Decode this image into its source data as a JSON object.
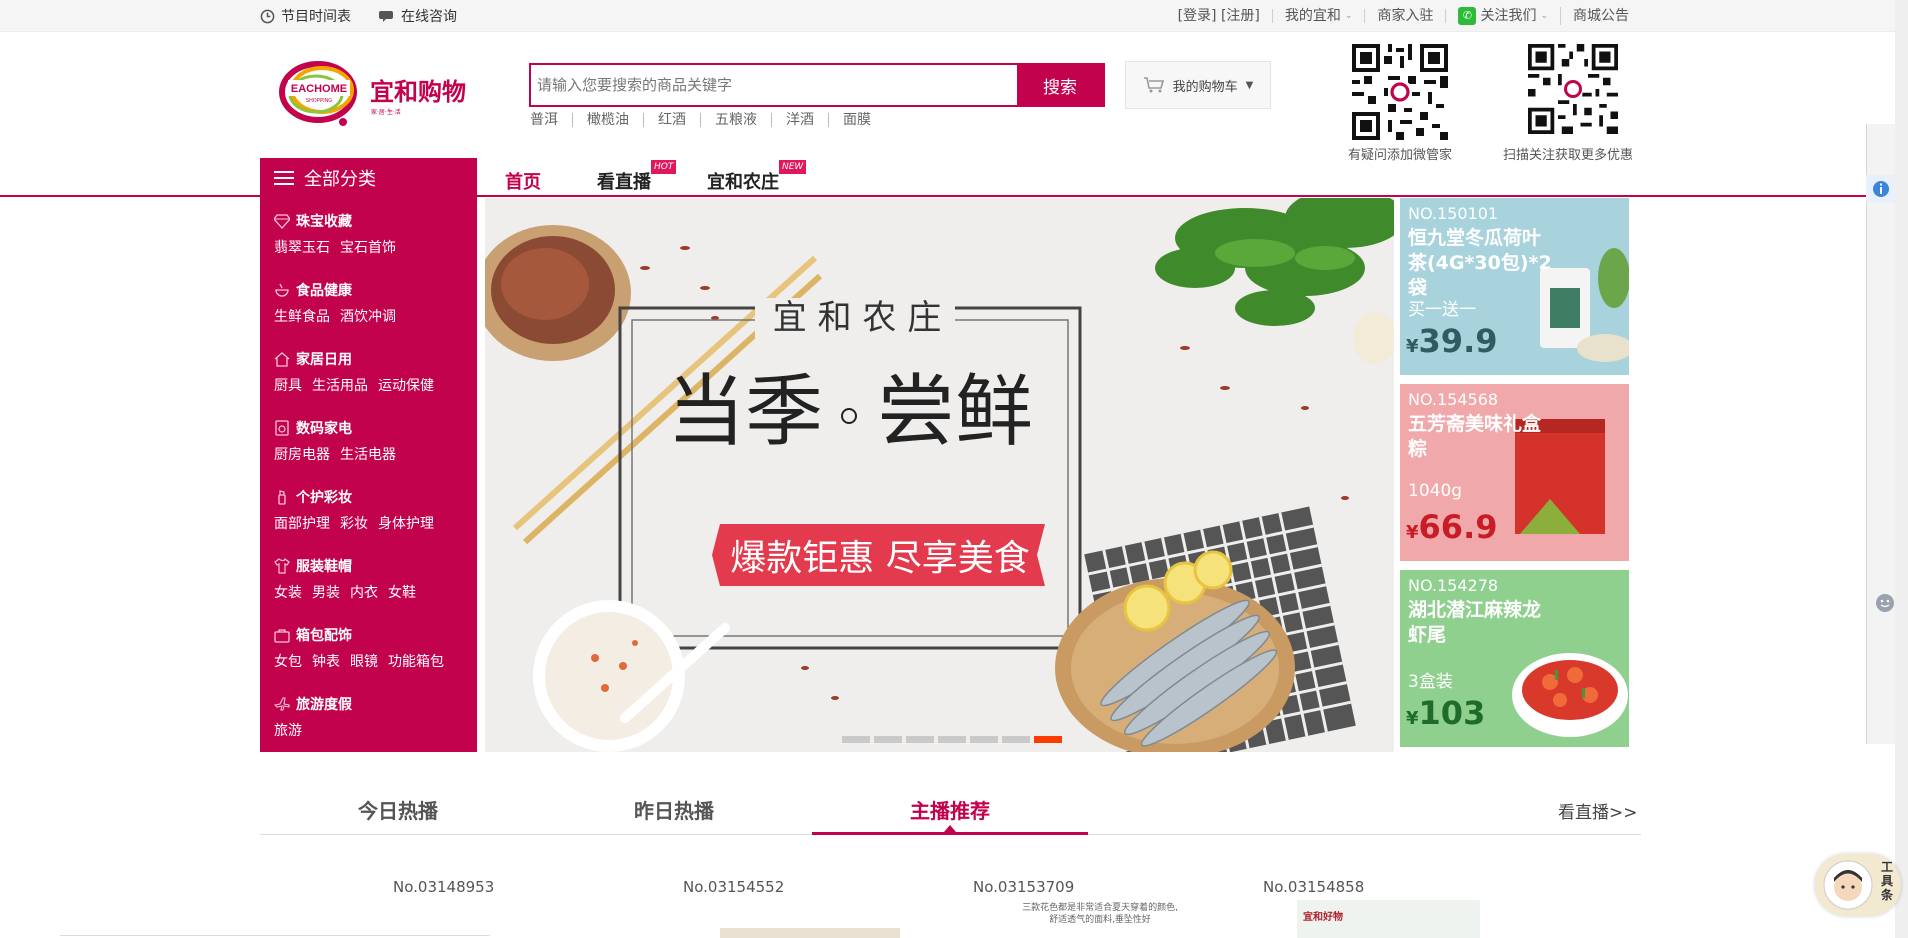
{
  "topbar": {
    "schedule": "节目时间表",
    "consult": "在线咨询",
    "login_register": "[登录] [注册]",
    "my_account": "我的宜和",
    "merchant": "商家入驻",
    "follow": "关注我们",
    "notice": "商城公告"
  },
  "logo": {
    "en": "EACHOME",
    "en_sub": "SHOPPING",
    "cn": "宜和购物",
    "slogan": "家·居·生·活"
  },
  "search": {
    "placeholder": "请输入您要搜索的商品关键字",
    "button": "搜索",
    "hotwords": [
      "普洱",
      "橄榄油",
      "红酒",
      "五粮液",
      "洋酒",
      "面膜"
    ]
  },
  "cart": {
    "label": "我的购物车"
  },
  "qrcodes": [
    {
      "caption": "有疑问添加微管家"
    },
    {
      "caption": "扫描关注获取更多优惠"
    }
  ],
  "nav": {
    "all_categories": "全部分类",
    "links": [
      {
        "label": "首页",
        "badge": ""
      },
      {
        "label": "看直播",
        "badge": "HOT"
      },
      {
        "label": "宜和农庄",
        "badge": "NEW"
      }
    ]
  },
  "categories": [
    {
      "title": "珠宝收藏",
      "subs": [
        "翡翠玉石",
        "宝石首饰"
      ]
    },
    {
      "title": "食品健康",
      "subs": [
        "生鲜食品",
        "酒饮冲调"
      ]
    },
    {
      "title": "家居日用",
      "subs": [
        "厨具",
        "生活用品",
        "运动保健"
      ]
    },
    {
      "title": "数码家电",
      "subs": [
        "厨房电器",
        "生活电器"
      ]
    },
    {
      "title": "个护彩妆",
      "subs": [
        "面部护理",
        "彩妆",
        "身体护理"
      ]
    },
    {
      "title": "服装鞋帽",
      "subs": [
        "女装",
        "男装",
        "内衣",
        "女鞋"
      ]
    },
    {
      "title": "箱包配饰",
      "subs": [
        "女包",
        "钟表",
        "眼镜",
        "功能箱包"
      ]
    },
    {
      "title": "旅游度假",
      "subs": [
        "旅游"
      ]
    }
  ],
  "banner": {
    "small_title": "宜 和 农 庄",
    "big_left": "当季",
    "big_right": "尝鲜",
    "ribbon": "爆款钜惠  尽享美食",
    "slides_total": 7,
    "active_slide": 7
  },
  "promos": [
    {
      "no": "NO.150101",
      "name": "恒九堂冬瓜荷叶茶(4G*30包)*2袋",
      "sub": "买一送一",
      "price": "39.9",
      "bg": "#a9d3dc"
    },
    {
      "no": "NO.154568",
      "name": "五芳斋美味礼盒粽",
      "sub": "1040g",
      "price": "66.9",
      "bg": "#f0a8aa"
    },
    {
      "no": "NO.154278",
      "name": "湖北潜江麻辣龙虾尾",
      "sub": "3盒装",
      "price": "103",
      "bg": "#8fd08f"
    }
  ],
  "tabs": {
    "items": [
      "今日热播",
      "昨日热播",
      "主播推荐"
    ],
    "active": 2,
    "more": "看直播>>"
  },
  "products": [
    {
      "no": "No.03148953"
    },
    {
      "no": "No.03154552"
    },
    {
      "no": "No.03153709",
      "caption1": "三款花色都是非常适合夏天穿着的颜色,",
      "caption2": "舒适透气的面料,垂坠性好"
    },
    {
      "no": "No.03154858",
      "brand": "宜和好物"
    }
  ],
  "side_tool": {
    "label": "工具条"
  },
  "colors": {
    "brand": "#c2024d",
    "accent": "#ff3c00"
  }
}
